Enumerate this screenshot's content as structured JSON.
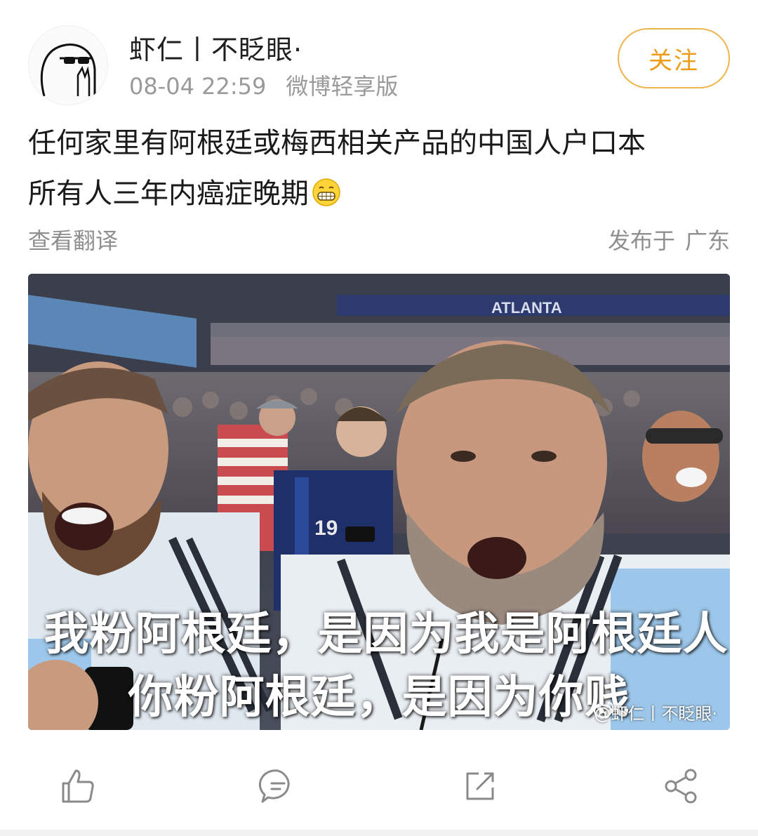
{
  "post": {
    "author": "虾仁丨不眨眼·",
    "time": "08-04 22:59",
    "source": "微博轻享版",
    "follow_label": "关注",
    "text_line1": "任何家里有阿根廷或梅西相关产品的中国人户口本",
    "text_line2": "所有人三年内癌症晚期",
    "emoji": "grin-emoji",
    "translate_label": "查看翻译",
    "location_prefix": "发布于",
    "location_region": "广东"
  },
  "image": {
    "stadium_sign": "ATLANTA",
    "jersey_number": "19",
    "caption_line1": "我粉阿根廷，是因为我是阿根廷人",
    "caption_line2": "你粉阿根廷，是因为你贱",
    "watermark": "@虾仁丨不眨眼·"
  },
  "actions": {
    "icons": [
      "like-icon",
      "comment-icon",
      "repost-icon",
      "share-icon"
    ]
  },
  "colors": {
    "accent": "#f09b18",
    "follow_border": "#f0b44c",
    "meta_gray": "#9a9a9a",
    "icon_gray": "#8a8a8a"
  }
}
